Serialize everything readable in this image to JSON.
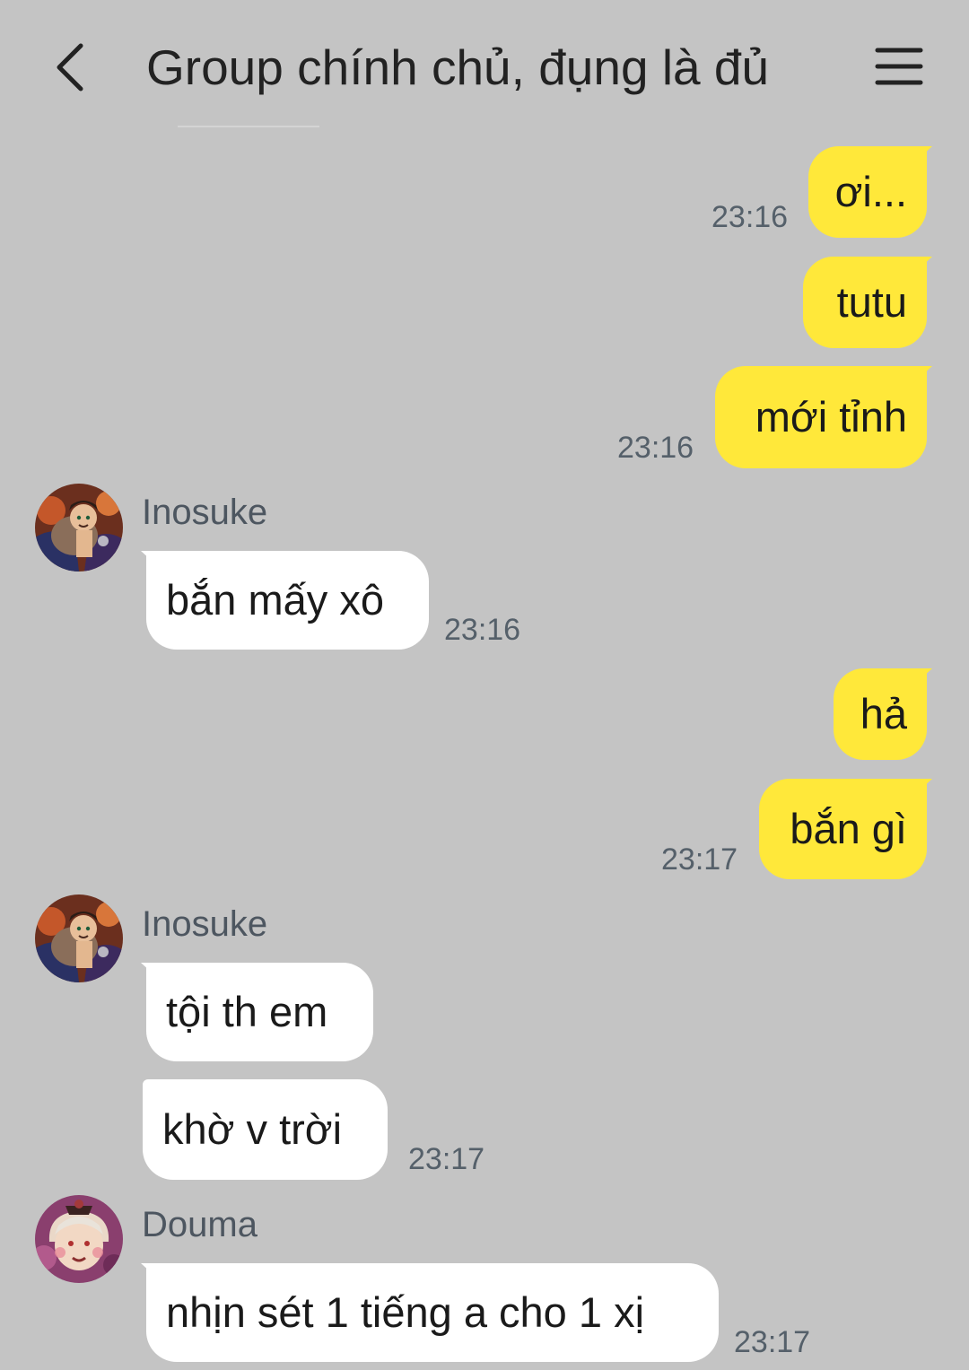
{
  "header": {
    "title": "Group chính chủ, đụng là đủ",
    "back_icon": "chevron-left-icon",
    "menu_icon": "hamburger-menu-icon"
  },
  "colors": {
    "background": "#c4c4c4",
    "my_bubble": "#ffe83a",
    "their_bubble": "#ffffff",
    "timestamp": "#55606a"
  },
  "messages": [
    {
      "from": "me",
      "text": "ơi...",
      "time": "23:16"
    },
    {
      "from": "me",
      "text": "tutu"
    },
    {
      "from": "me",
      "text": "mới tỉnh",
      "time": "23:16"
    },
    {
      "from": "Inosuke",
      "sender_label": "Inosuke",
      "avatar_icon": "inosuke-avatar",
      "text": "bắn mấy xô",
      "time": "23:16"
    },
    {
      "from": "me",
      "text": "hả"
    },
    {
      "from": "me",
      "text": "bắn gì",
      "time": "23:17"
    },
    {
      "from": "Inosuke",
      "sender_label": "Inosuke",
      "avatar_icon": "inosuke-avatar",
      "text": "tội th em"
    },
    {
      "from": "Inosuke",
      "text": "khờ v trời",
      "time": "23:17"
    },
    {
      "from": "Douma",
      "sender_label": "Douma",
      "avatar_icon": "douma-avatar",
      "text": "nhịn sét 1 tiếng a cho 1 xị",
      "time": "23:17"
    }
  ]
}
